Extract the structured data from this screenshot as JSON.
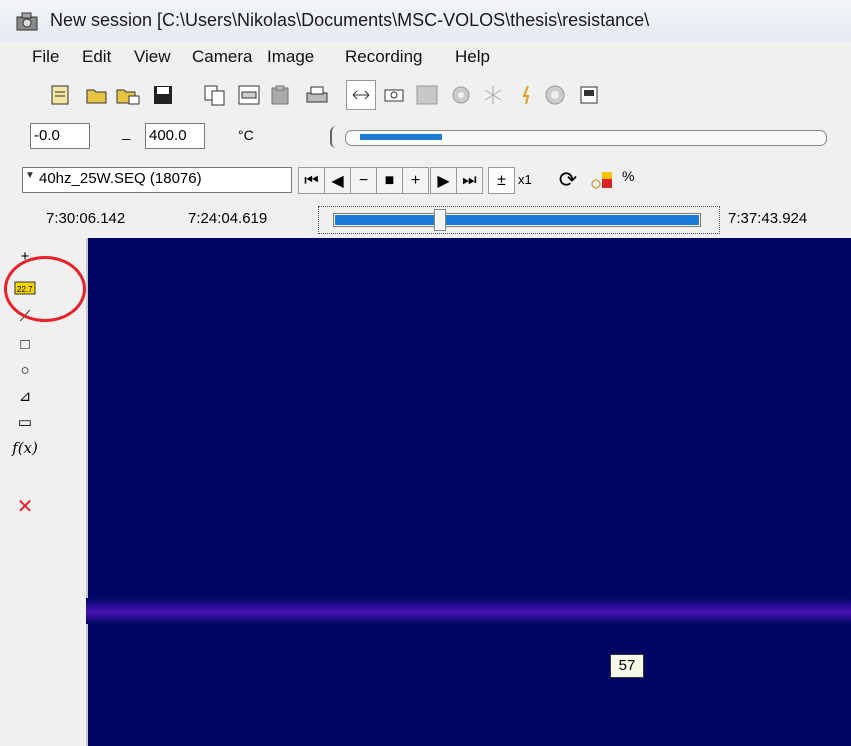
{
  "window": {
    "title": "New session [C:\\Users\\Nikolas\\Documents\\MSC-VOLOS\\thesis\\resistance\\"
  },
  "menu": [
    "File",
    "Edit",
    "View",
    "Camera",
    "Image",
    "Recording",
    "Help"
  ],
  "range": {
    "min": "-0.0",
    "max": "400.0",
    "dash": "_",
    "unit": "°C"
  },
  "playback": {
    "sequence": "40hz_25W.SEQ (18076)",
    "speed": "x1",
    "progress_fraction": 0.29
  },
  "times": {
    "current": "7:30:06.142",
    "start": "7:24:04.619",
    "end": "7:37:43.924"
  },
  "tools": {
    "label_tool_text": "22.7",
    "fx": "f(x)"
  },
  "viewer": {
    "spot_value": "57"
  },
  "colors": {
    "viewer_bg": "#010664",
    "stripe": "#4a12b4",
    "highlight": "#e8202a",
    "slider_fill": "#1d7bd8"
  }
}
